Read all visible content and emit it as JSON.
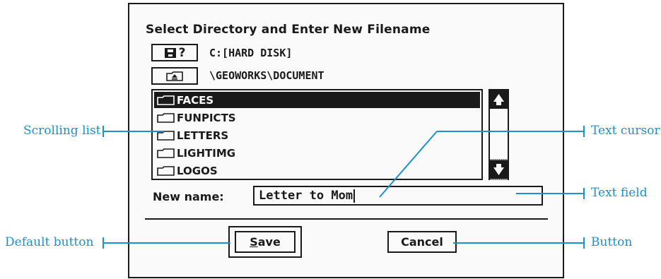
{
  "dialog": {
    "title": "Select Directory and Enter New Filename",
    "drive_button_label": "?",
    "drive_text": "C:[HARD DISK]",
    "path_text": "\\GEOWORKS\\DOCUMENT",
    "list_items": [
      {
        "label": "FACES",
        "selected": true
      },
      {
        "label": "FUNPICTS",
        "selected": false
      },
      {
        "label": "LETTERS",
        "selected": false
      },
      {
        "label": "LIGHTIMG",
        "selected": false
      },
      {
        "label": "LOGOS",
        "selected": false
      }
    ],
    "new_name_label": "New name:",
    "new_name_value": "Letter to Mom",
    "save_label_underlined": "S",
    "save_label_rest": "ave",
    "cancel_label": "Cancel"
  },
  "callouts": {
    "scrolling_list": "Scrolling list",
    "default_button": "Default button",
    "text_cursor": "Text cursor",
    "text_field": "Text field",
    "button": "Button"
  },
  "icons": {
    "drive": "disk-drive-icon",
    "up": "parent-folder-icon",
    "folder": "folder-icon",
    "scroll_up": "scroll-up-arrow-icon",
    "scroll_down": "scroll-down-arrow-icon"
  },
  "colors": {
    "annotation": "#1e8fd0",
    "ink": "#1a1a1a",
    "background": "#fafafa"
  }
}
